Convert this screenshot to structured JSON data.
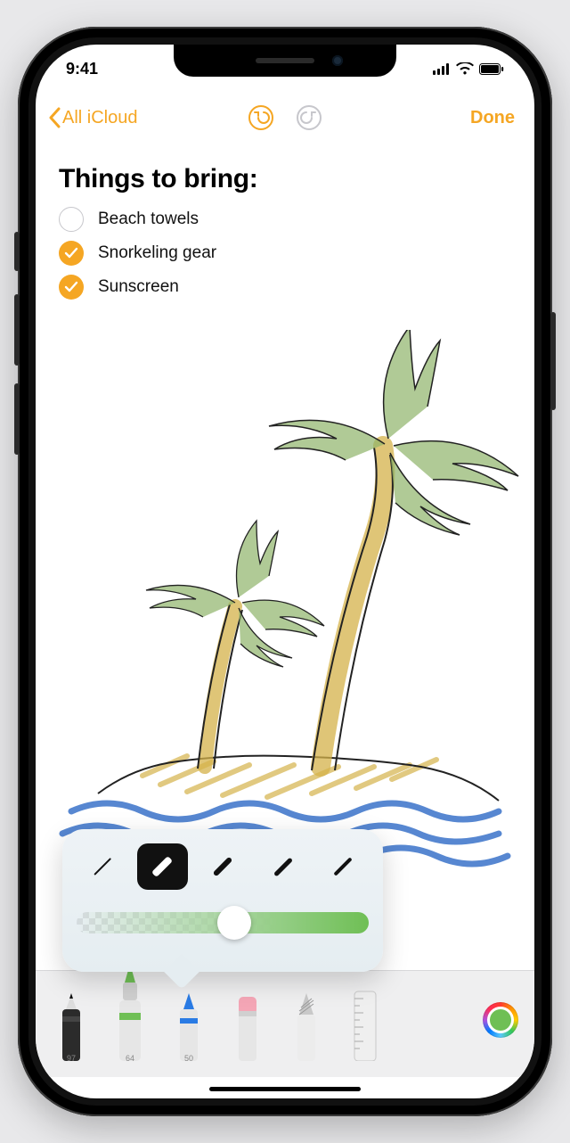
{
  "status": {
    "time": "9:41"
  },
  "nav": {
    "back_label": "All iCloud",
    "done_label": "Done"
  },
  "note": {
    "title": "Things to bring:",
    "checklist": [
      {
        "label": "Beach towels",
        "checked": false
      },
      {
        "label": "Snorkeling gear",
        "checked": true
      },
      {
        "label": "Sunscreen",
        "checked": true
      }
    ]
  },
  "brush_popup": {
    "sizes": [
      1,
      5,
      4,
      3,
      2
    ],
    "selected_index": 1,
    "opacity": 0.55
  },
  "tools": {
    "items": [
      {
        "name": "pen",
        "label": "97"
      },
      {
        "name": "marker",
        "label": "64",
        "selected": true
      },
      {
        "name": "pencil",
        "label": "50"
      },
      {
        "name": "eraser",
        "label": ""
      },
      {
        "name": "lasso",
        "label": ""
      },
      {
        "name": "ruler",
        "label": ""
      }
    ],
    "selected_color": "#6fbf55"
  }
}
